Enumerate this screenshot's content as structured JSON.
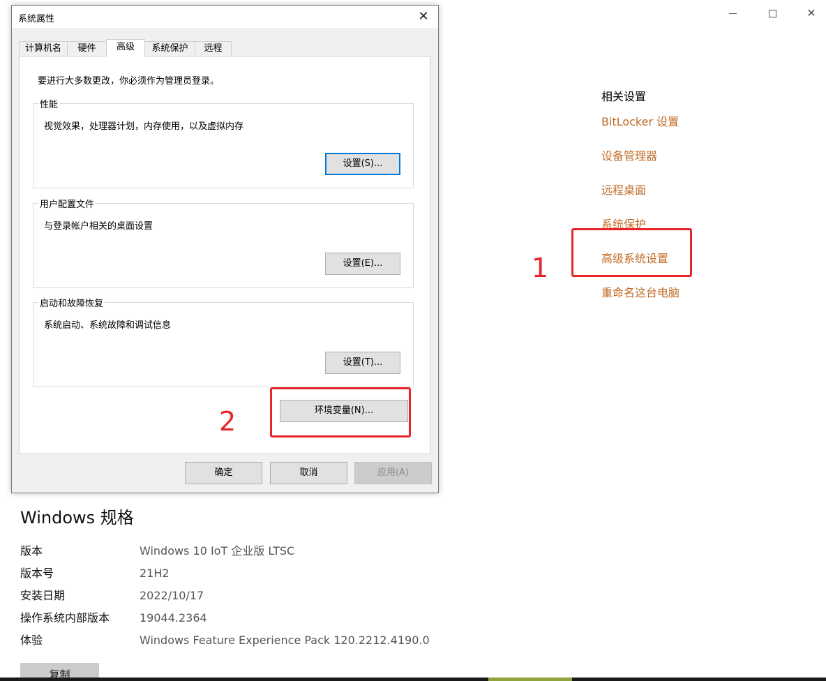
{
  "window_controls": {
    "minimize": "minimize",
    "maximize": "maximize",
    "close": "✕"
  },
  "related": {
    "title": "相关设置",
    "links": [
      "BitLocker 设置",
      "设备管理器",
      "远程桌面",
      "系统保护",
      "高级系统设置",
      "重命名这台电脑"
    ],
    "link_color": "#c06a25"
  },
  "spec": {
    "title": "Windows 规格",
    "rows": [
      {
        "label": "版本",
        "value": "Windows 10 IoT 企业版 LTSC"
      },
      {
        "label": "版本号",
        "value": "21H2"
      },
      {
        "label": "安装日期",
        "value": "2022/10/17"
      },
      {
        "label": "操作系统内部版本",
        "value": "19044.2364"
      },
      {
        "label": "体验",
        "value": "Windows Feature Experience Pack 120.2212.4190.0"
      }
    ],
    "copy_label": "复制"
  },
  "dialog": {
    "title": "系统属性",
    "close": "✕",
    "tabs": [
      "计算机名",
      "硬件",
      "高级",
      "系统保护",
      "远程"
    ],
    "active_tab": "高级",
    "note": "要进行大多数更改，你必须作为管理员登录。",
    "groups": [
      {
        "legend": "性能",
        "desc": "视觉效果，处理器计划，内存使用，以及虚拟内存",
        "button": "设置(S)..."
      },
      {
        "legend": "用户配置文件",
        "desc": "与登录帐户相关的桌面设置",
        "button": "设置(E)..."
      },
      {
        "legend": "启动和故障恢复",
        "desc": "系统启动、系统故障和调试信息",
        "button": "设置(T)..."
      }
    ],
    "env_button": "环境变量(N)...",
    "ok": "确定",
    "cancel": "取消",
    "apply": "应用(A)"
  },
  "annotations": {
    "step1": "1",
    "step2": "2",
    "color": "#e8242b"
  }
}
